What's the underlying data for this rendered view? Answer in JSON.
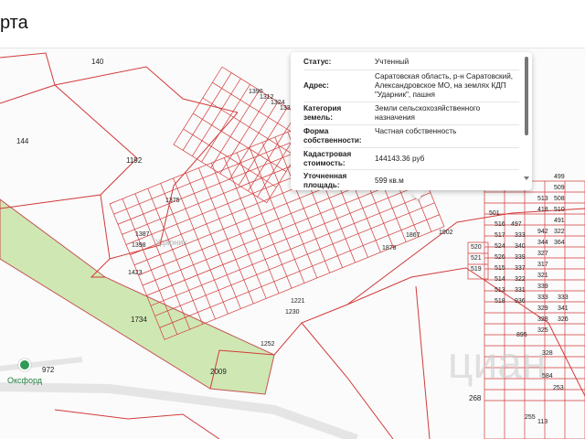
{
  "header": {
    "title": "рта"
  },
  "popup": {
    "rows": [
      {
        "key": "Статус:",
        "value": "Учтенный"
      },
      {
        "key": "Адрес:",
        "value": "Саратовская область, р-н Саратовский, Александровское МО, на землях КДП \"Ударник\", пашня"
      },
      {
        "key": "Категория земель:",
        "value": "Земли сельскохозяйственного назначения"
      },
      {
        "key": "Форма собственности:",
        "value": "Частная собственность"
      },
      {
        "key": "Кадастровая стоимость:",
        "value": "144143.36 руб"
      },
      {
        "key": "Уточненная площадь:",
        "value": "599 кв.м"
      }
    ]
  },
  "map": {
    "plot_labels": [
      "140",
      "144",
      "1192",
      "1734",
      "2009",
      "972",
      "268",
      "1375",
      "1387",
      "1398",
      "1423",
      "1221",
      "1230",
      "1252",
      "1867",
      "1878",
      "1902",
      "1390",
      "1312",
      "1324",
      "1336",
      "501",
      "497",
      "516",
      "517",
      "333",
      "524",
      "340",
      "526",
      "339",
      "515",
      "337",
      "514",
      "322",
      "513",
      "331",
      "518",
      "936",
      "895",
      "499",
      "509",
      "513",
      "508",
      "418",
      "510",
      "491",
      "520",
      "521",
      "519",
      "942",
      "322",
      "344",
      "364",
      "327",
      "317",
      "321",
      "339",
      "333",
      "333",
      "329",
      "341",
      "328",
      "326",
      "325",
      "328",
      "584",
      "253",
      "255",
      "113",
      "12"
    ],
    "town_label": "Оксфорд",
    "area_labels": [
      "Ударник"
    ],
    "watermark": "циан"
  },
  "colors": {
    "parcel": "#d23a3a",
    "green_field": "#cfe8b3",
    "road": "#dcdcdc",
    "accent": "#2f9a57"
  }
}
